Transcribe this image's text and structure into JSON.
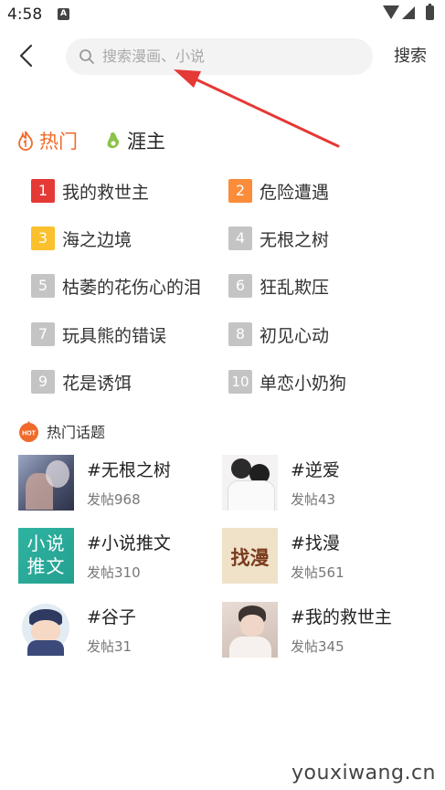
{
  "status_bar": {
    "time": "4:58",
    "notif_letter": "A"
  },
  "header": {
    "search_placeholder": "搜索漫画、小说",
    "search_button": "搜索"
  },
  "colors": {
    "accent": "#f06a2a",
    "arrow": "#e53935",
    "rank1": "#e53935",
    "rank2": "#fb8c3a",
    "rank3": "#fbc02d",
    "rank_other": "#c4c4c4"
  },
  "tabs": [
    {
      "label": "热门",
      "icon": "flame-icon"
    },
    {
      "label": "涯主",
      "icon": "pear-icon"
    }
  ],
  "rankings": [
    {
      "num": "1",
      "title": "我的救世主"
    },
    {
      "num": "2",
      "title": "危险遭遇"
    },
    {
      "num": "3",
      "title": "海之边境"
    },
    {
      "num": "4",
      "title": "无根之树"
    },
    {
      "num": "5",
      "title": "枯萎的花伤心的泪"
    },
    {
      "num": "6",
      "title": "狂乱欺压"
    },
    {
      "num": "7",
      "title": "玩具熊的错误"
    },
    {
      "num": "8",
      "title": "初见心动"
    },
    {
      "num": "9",
      "title": "花是诱饵"
    },
    {
      "num": "10",
      "title": "单恋小奶狗"
    }
  ],
  "hot_topics": {
    "badge": "HOT",
    "title": "热门话题",
    "items": [
      {
        "name": "#无根之树",
        "count": "发帖968"
      },
      {
        "name": "#逆爱",
        "count": "发帖43"
      },
      {
        "name": "#小说推文",
        "count": "发帖310",
        "thumb_text": "小说推文"
      },
      {
        "name": "#找漫",
        "count": "发帖561",
        "thumb_text": "找漫"
      },
      {
        "name": "#谷子",
        "count": "发帖31"
      },
      {
        "name": "#我的救世主",
        "count": "发帖345"
      }
    ]
  },
  "watermark": "youxiwang.cn"
}
